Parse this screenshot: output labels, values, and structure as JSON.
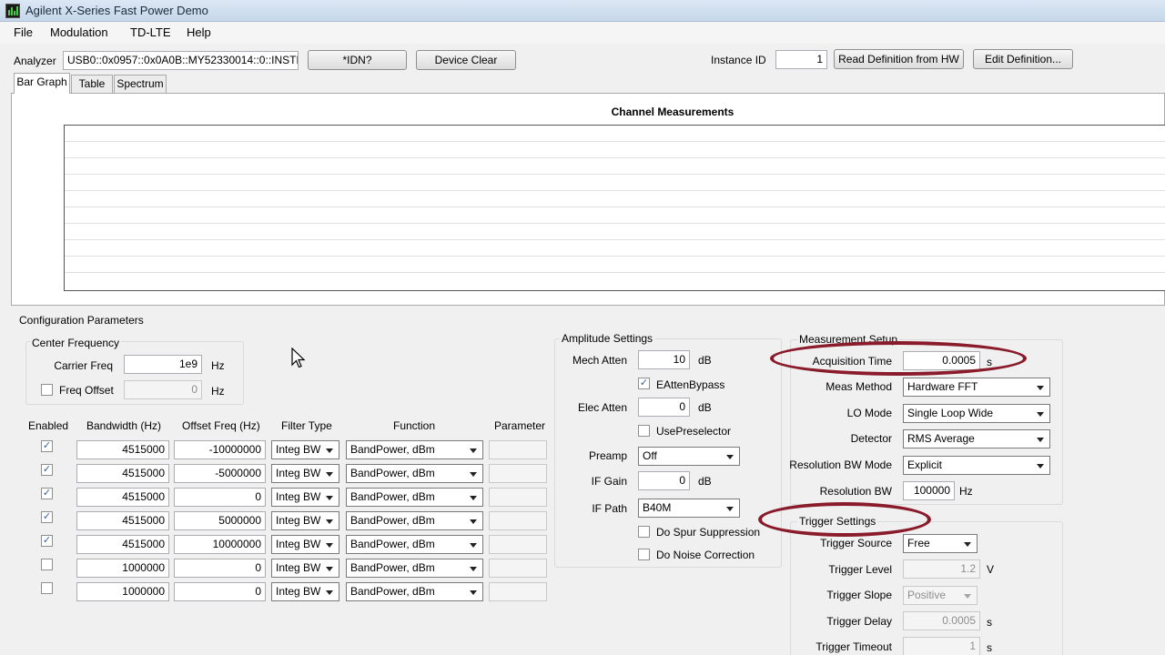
{
  "window": {
    "title": "Agilent X-Series Fast Power Demo"
  },
  "menu": [
    "File",
    "Modulation",
    "TD-LTE",
    "Help"
  ],
  "toolbar": {
    "analyzer_label": "Analyzer",
    "analyzer_address": "USB0::0x0957::0x0A0B::MY52330014::0::INSTR",
    "idn_button": "*IDN?",
    "device_clear_button": "Device Clear",
    "instance_id_label": "Instance ID",
    "instance_id_value": "1",
    "read_definition_button": "Read Definition from HW",
    "edit_definition_button": "Edit Definition..."
  },
  "tabs": [
    "Bar Graph",
    "Table",
    "Spectrum"
  ],
  "chart": {
    "title": "Channel Measurements"
  },
  "config": {
    "title": "Configuration Parameters",
    "center_freq": {
      "title": "Center Frequency",
      "carrier_freq_label": "Carrier Freq",
      "carrier_freq_value": "1e9",
      "carrier_freq_unit": "Hz",
      "freq_offset_label": "Freq Offset",
      "freq_offset_value": "0",
      "freq_offset_unit": "Hz"
    },
    "table": {
      "headers": [
        "Enabled",
        "Bandwidth (Hz)",
        "Offset Freq (Hz)",
        "Filter Type",
        "Function",
        "Parameter"
      ],
      "rows": [
        {
          "enabled": true,
          "bandwidth": "4515000",
          "offset": "-10000000",
          "filter": "Integ BW",
          "function": "BandPower, dBm"
        },
        {
          "enabled": true,
          "bandwidth": "4515000",
          "offset": "-5000000",
          "filter": "Integ BW",
          "function": "BandPower, dBm"
        },
        {
          "enabled": true,
          "bandwidth": "4515000",
          "offset": "0",
          "filter": "Integ BW",
          "function": "BandPower, dBm"
        },
        {
          "enabled": true,
          "bandwidth": "4515000",
          "offset": "5000000",
          "filter": "Integ BW",
          "function": "BandPower, dBm"
        },
        {
          "enabled": true,
          "bandwidth": "4515000",
          "offset": "10000000",
          "filter": "Integ BW",
          "function": "BandPower, dBm"
        },
        {
          "enabled": false,
          "bandwidth": "1000000",
          "offset": "0",
          "filter": "Integ BW",
          "function": "BandPower, dBm"
        },
        {
          "enabled": false,
          "bandwidth": "1000000",
          "offset": "0",
          "filter": "Integ BW",
          "function": "BandPower, dBm"
        }
      ]
    }
  },
  "amplitude": {
    "title": "Amplitude Settings",
    "mech_atten_label": "Mech Atten",
    "mech_atten_value": "10",
    "mech_atten_unit": "dB",
    "eatten_bypass_label": "EAttenBypass",
    "elec_atten_label": "Elec Atten",
    "elec_atten_value": "0",
    "elec_atten_unit": "dB",
    "use_preselector_label": "UsePreselector",
    "preamp_label": "Preamp",
    "preamp_value": "Off",
    "if_gain_label": "IF Gain",
    "if_gain_value": "0",
    "if_gain_unit": "dB",
    "if_path_label": "IF Path",
    "if_path_value": "B40M",
    "spur_label": "Do Spur Suppression",
    "noise_label": "Do Noise Correction"
  },
  "measurement": {
    "title": "Measurement Setup",
    "acq_time_label": "Acquisition Time",
    "acq_time_value": "0.0005",
    "acq_time_unit": "s",
    "meas_method_label": "Meas Method",
    "meas_method_value": "Hardware FFT",
    "lo_mode_label": "LO Mode",
    "lo_mode_value": "Single Loop Wide",
    "detector_label": "Detector",
    "detector_value": "RMS Average",
    "res_bw_mode_label": "Resolution BW Mode",
    "res_bw_mode_value": "Explicit",
    "res_bw_label": "Resolution BW",
    "res_bw_value": "100000",
    "res_bw_unit": "Hz"
  },
  "trigger": {
    "title": "Trigger Settings",
    "source_label": "Trigger Source",
    "source_value": "Free",
    "level_label": "Trigger Level",
    "level_value": "1.2",
    "level_unit": "V",
    "slope_label": "Trigger Slope",
    "slope_value": "Positive",
    "delay_label": "Trigger Delay",
    "delay_value": "0.0005",
    "delay_unit": "s",
    "timeout_label": "Trigger Timeout",
    "timeout_value": "1",
    "timeout_unit": "s"
  },
  "colors": {
    "highlight_ring": "#8a1b2b",
    "title_bar": "#c6d7ea",
    "window_bg": "#f0f0f0"
  }
}
